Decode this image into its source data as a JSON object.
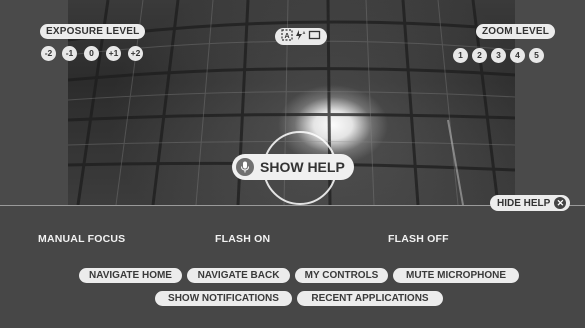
{
  "exposure": {
    "title": "EXPOSURE LEVEL",
    "levels": [
      "-2",
      "-1",
      "0",
      "+1",
      "+2"
    ]
  },
  "zoom": {
    "title": "ZOOM LEVEL",
    "levels": [
      "1",
      "2",
      "3",
      "4",
      "5"
    ]
  },
  "mode_indicator": {
    "icons": [
      "auto-mode-icon",
      "flash-auto-icon",
      "aspect-ratio-icon"
    ]
  },
  "show_help": {
    "label": "SHOW HELP",
    "icon": "microphone-icon"
  },
  "hide_help": {
    "label": "HIDE HELP",
    "icon": "close-icon"
  },
  "voice_commands": [
    "MANUAL FOCUS",
    "FLASH ON",
    "FLASH OFF"
  ],
  "system_commands": {
    "row1": [
      "NAVIGATE HOME",
      "NAVIGATE BACK",
      "MY CONTROLS",
      "MUTE MICROPHONE"
    ],
    "row2": [
      "SHOW NOTIFICATIONS",
      "RECENT APPLICATIONS"
    ]
  },
  "colors": {
    "background": "#4a4a4a",
    "chip": "#ececec",
    "chip_text": "#333333"
  }
}
